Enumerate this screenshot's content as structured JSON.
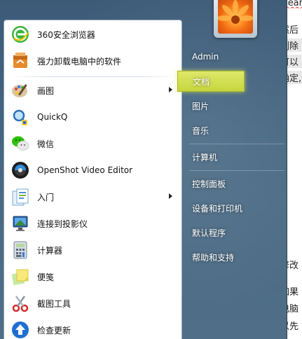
{
  "background_doc": {
    "fragments": [
      "Clear",
      "然后",
      "删除",
      "可以",
      "确定,",
      "修改",
      "如果",
      "电脑",
      "以先"
    ]
  },
  "start_menu": {
    "user_name": "Admin",
    "programs": [
      {
        "label": "360安全浏览器",
        "icon": "360-browser-icon",
        "has_submenu": false
      },
      {
        "label": "强力卸载电脑中的软件",
        "icon": "uninstall-box-icon",
        "has_submenu": false
      },
      {
        "label": "画图",
        "icon": "paint-palette-icon",
        "has_submenu": true
      },
      {
        "label": "QuickQ",
        "icon": "quickq-magnifier-icon",
        "has_submenu": false
      },
      {
        "label": "微信",
        "icon": "wechat-icon",
        "has_submenu": false
      },
      {
        "label": "OpenShot Video Editor",
        "icon": "openshot-icon",
        "has_submenu": false
      },
      {
        "label": "入门",
        "icon": "getting-started-icon",
        "has_submenu": true
      },
      {
        "label": "连接到投影仪",
        "icon": "projector-icon",
        "has_submenu": false
      },
      {
        "label": "计算器",
        "icon": "calculator-icon",
        "has_submenu": false
      },
      {
        "label": "便笺",
        "icon": "sticky-notes-icon",
        "has_submenu": false
      },
      {
        "label": "截图工具",
        "icon": "snipping-tool-icon",
        "has_submenu": false
      },
      {
        "label": "检查更新",
        "icon": "check-update-icon",
        "has_submenu": false
      }
    ],
    "right_links": [
      {
        "label": "文档",
        "hover": true
      },
      {
        "label": "图片"
      },
      {
        "label": "音乐"
      },
      {
        "label": "计算机"
      },
      {
        "label": "控制面板"
      },
      {
        "label": "设备和打印机"
      },
      {
        "label": "默认程序"
      },
      {
        "label": "帮助和支持"
      }
    ],
    "colors": {
      "menu_background": "#42637f",
      "hover_highlight": "#d4e050",
      "left_pane": "#ffffff"
    }
  }
}
